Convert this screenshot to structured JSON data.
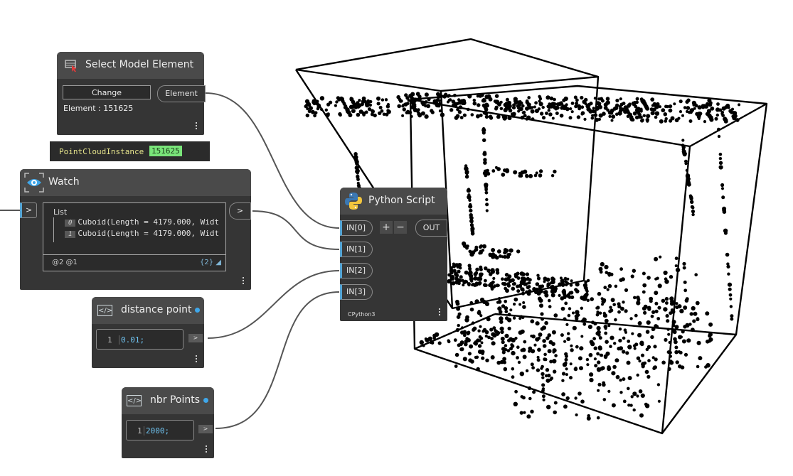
{
  "nodes": {
    "select_element": {
      "title": "Select Model Element",
      "button_label": "Change",
      "output_label": "Element",
      "status_text": "Element : 151625"
    },
    "tooltip": {
      "type_label": "PointCloudInstance",
      "value": "151625"
    },
    "watch": {
      "title": "Watch",
      "input_label": ">",
      "output_label": ">",
      "list_label": "List",
      "items": [
        {
          "index": "0",
          "text": "Cuboid(Length = 4179.000, Widt"
        },
        {
          "index": "1",
          "text": "Cuboid(Length = 4179.000, Widt"
        }
      ],
      "levels": "@2 @1",
      "count": "{2}"
    },
    "python_script": {
      "title": "Python Script",
      "inputs": [
        "IN[0]",
        "IN[1]",
        "IN[2]",
        "IN[3]"
      ],
      "add_label": "+",
      "remove_label": "−",
      "output_label": "OUT",
      "engine": "CPython3"
    },
    "distance_point": {
      "title": "distance point",
      "line_number": "1",
      "code": "0.01;",
      "output_label": ">"
    },
    "nbr_points": {
      "title": "nbr Points",
      "line_number": "1",
      "code": "2000;",
      "output_label": ">"
    }
  },
  "icons": {
    "select_node_icon": "cursor-select-icon",
    "watch_node_icon": "eye-icon",
    "python_node_icon": "python-logo-icon",
    "code_block_icon": "code-brackets-icon"
  },
  "colors": {
    "canvas": "#ffffff",
    "node_body": "#353535",
    "node_header": "#4a4a4a",
    "port_accent": "#56a6d6",
    "wire": "#555555",
    "highlight_green": "#7ae57a",
    "code_value": "#6fc3f0",
    "preview_points": "#000000"
  },
  "preview": {
    "point_count": 2000
  }
}
